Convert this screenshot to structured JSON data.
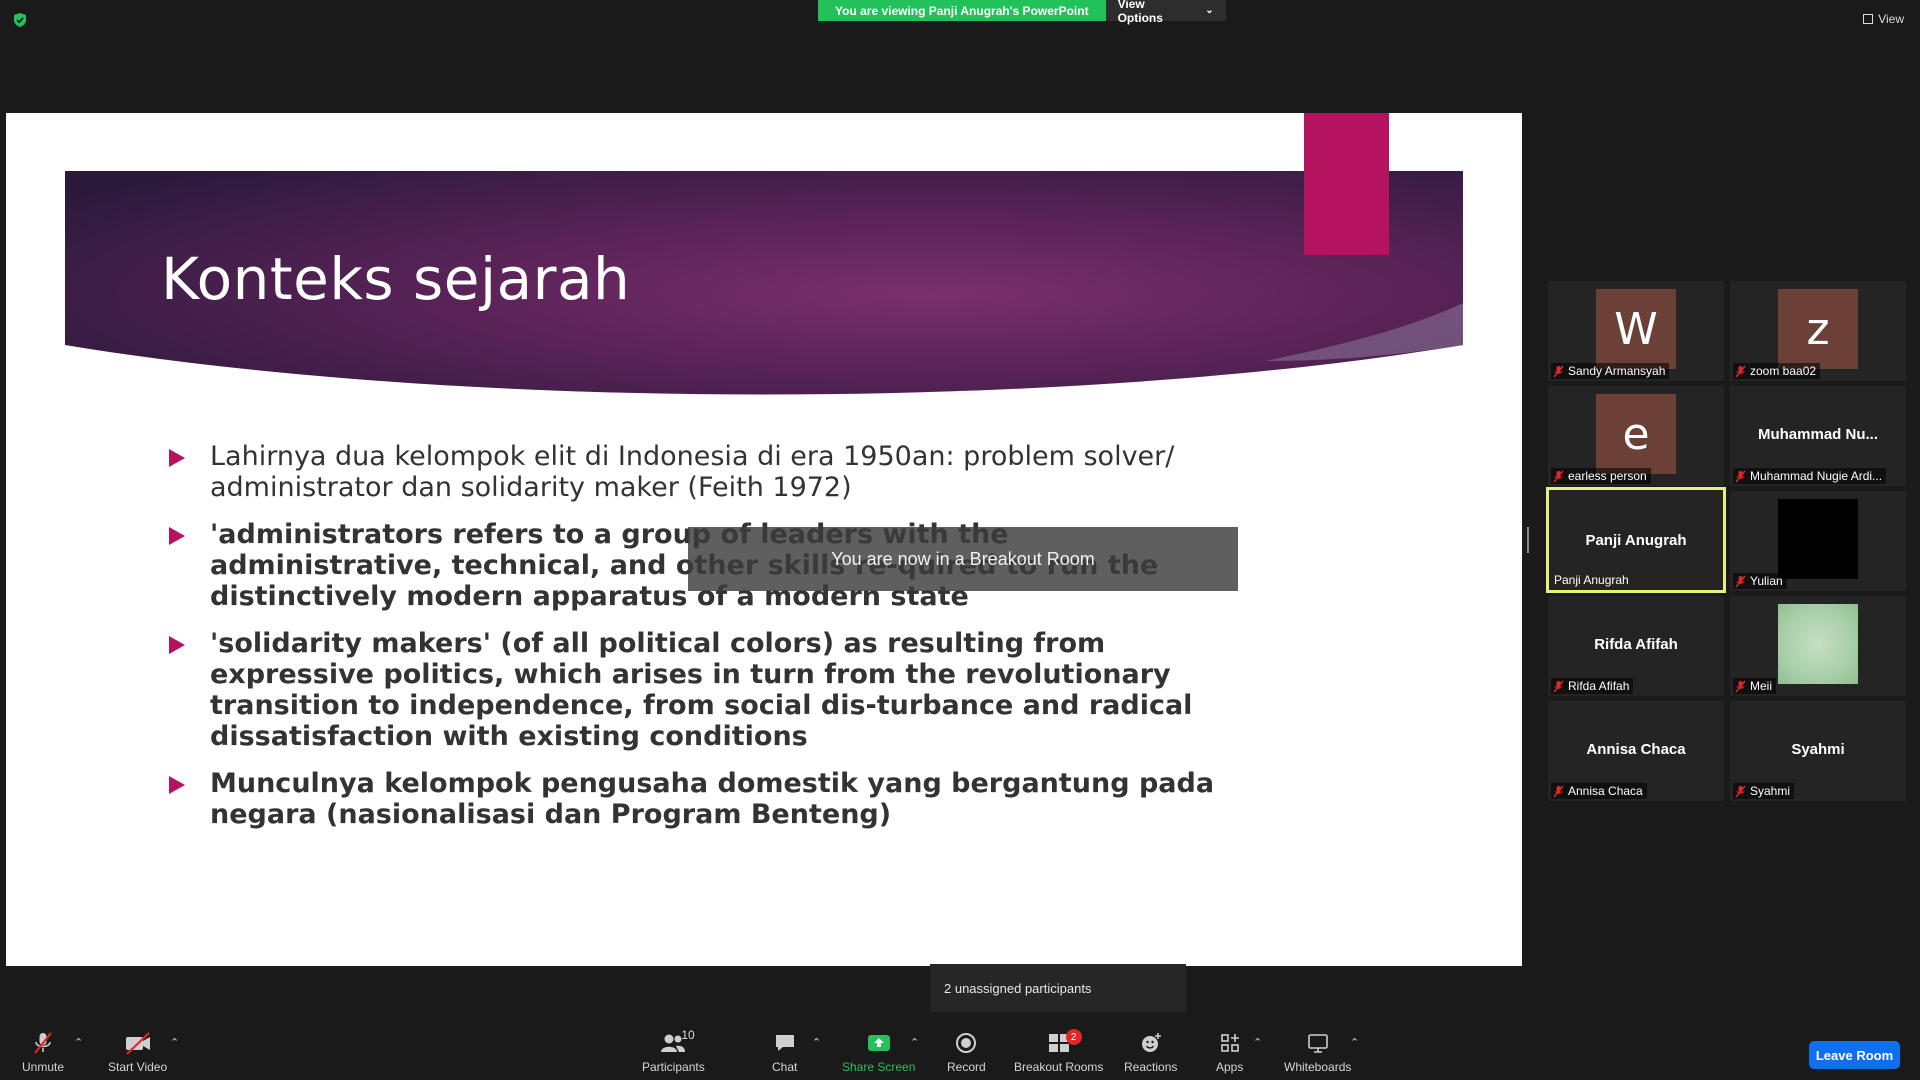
{
  "top": {
    "viewing_banner": "You are viewing Panji Anugrah's PowerPoint",
    "view_options": "View Options",
    "view": "View"
  },
  "slide": {
    "title": "Konteks sejarah",
    "bullets": [
      "Lahirnya dua kelompok elit di Indonesia di era 1950an: problem solver/ administrator dan solidarity maker (Feith 1972)",
      "'administrators refers to a group of leaders with the administrative, technical, and other skills re-quired to run the distinctively modern apparatus of a modern state",
      "'solidarity makers' (of all political colors) as resulting from expressive politics, which arises in turn from the revolutionary transition to independence, from social dis-turbance and radical dissatisfaction with existing conditions",
      "Munculnya kelompok pengusaha domestik yang bergantung pada negara (nasionalisasi dan Program Benteng)"
    ],
    "accent_color": "#b5135f"
  },
  "toast": "You are now in a Breakout Room",
  "gallery": [
    {
      "name": "Sandy Armansyah",
      "avatar": "W",
      "muted": true
    },
    {
      "name": "zoom baa02",
      "avatar": "z",
      "muted": true
    },
    {
      "name": "earless person",
      "avatar": "e",
      "muted": true
    },
    {
      "name": "Muhammad Nugie Ardi...",
      "big_name": "Muhammad  Nu...",
      "muted": true
    },
    {
      "name": "Panji Anugrah",
      "big_name": "Panji Anugrah",
      "muted": false,
      "active": true
    },
    {
      "name": "Yulian",
      "muted": true
    },
    {
      "name": "Rifda Afifah",
      "big_name": "Rifda Afifah",
      "muted": true
    },
    {
      "name": "Meii",
      "muted": true
    },
    {
      "name": "Annisa Chaca",
      "big_name": "Annisa Chaca",
      "muted": true
    },
    {
      "name": "Syahmi",
      "big_name": "Syahmi",
      "muted": true
    }
  ],
  "tooltip": "2 unassigned participants",
  "toolbar": {
    "unmute": "Unmute",
    "start_video": "Start Video",
    "participants": "Participants",
    "participants_count": "10",
    "chat": "Chat",
    "share_screen": "Share Screen",
    "record": "Record",
    "breakout_rooms": "Breakout Rooms",
    "breakout_badge": "2",
    "reactions": "Reactions",
    "apps": "Apps",
    "whiteboards": "Whiteboards",
    "leave_room": "Leave Room"
  },
  "colors": {
    "share_green": "#23c15a",
    "leave_blue": "#0e71eb",
    "active_speaker": "#e6f07a",
    "mute_red": "#e02828"
  }
}
